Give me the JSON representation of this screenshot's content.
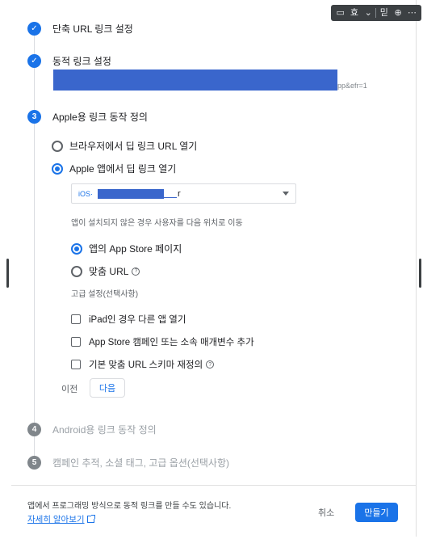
{
  "toolbar": {
    "items": [
      "comment-icon",
      "text-icon",
      "dropdown-icon",
      "note-icon",
      "download-icon",
      "more-icon"
    ],
    "glyphs": [
      "▭",
      "효",
      "⌄",
      "믿",
      "⊕",
      "⋯"
    ]
  },
  "steps": [
    {
      "num": "✓",
      "title": "단축 URL 링크 설정",
      "state": "done"
    },
    {
      "num": "✓",
      "title": "동적 링크 설정",
      "state": "done"
    },
    {
      "num": "3",
      "title": "Apple용 링크 동작 정의",
      "state": "active"
    },
    {
      "num": "4",
      "title": "Android용 링크 동작 정의",
      "state": "pending"
    },
    {
      "num": "5",
      "title": "캠페인 추적, 소셜 태그, 고급 옵션(선택사항)",
      "state": "pending"
    }
  ],
  "dynamic_link": {
    "url_tail": "pp&efr=1"
  },
  "apple": {
    "option_browser": "브라우저에서 딥 링크 URL 열기",
    "option_app": "Apple 앱에서 딥 링크 열기",
    "app_select": {
      "prefix": "iOS·",
      "tail": "r"
    },
    "not_installed_hint": "앱이 설치되지 않은 경우 사용자를 다음 위치로 이동",
    "dest_appstore": "앱의 App Store 페이지",
    "dest_custom": "맞춤 URL",
    "advanced_label": "고급 설정(선택사항)",
    "checks": [
      "iPad인 경우 다른 앱 열기",
      "App Store 캠페인 또는 소속 매개변수 추가",
      "기본 맞춤 URL 스키마 재정의"
    ],
    "prev": "이전",
    "next": "다음"
  },
  "footer": {
    "text": "앱에서 프로그래밍 방식으로 동적 링크를 만들 수도 있습니다.",
    "link": "자세히 알아보기",
    "cancel": "취소",
    "create": "만들기"
  },
  "colors": {
    "accent": "#1a73e8",
    "redaction": "#3a66cc",
    "muted": "#9aa0a6"
  }
}
